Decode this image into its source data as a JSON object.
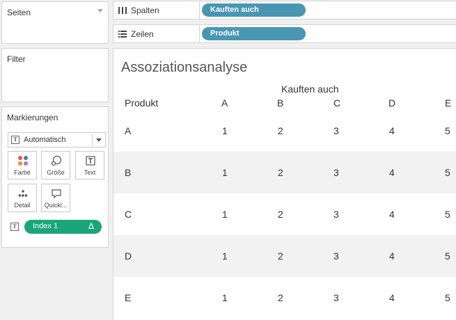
{
  "left": {
    "pages_title": "Seiten",
    "filter_title": "Filter",
    "marks_title": "Markierungen",
    "mark_type": "Automatisch",
    "mark_buttons": [
      "Farbe",
      "Größe",
      "Text",
      "Detail",
      "Quickl..."
    ],
    "mark_field": "Index 1",
    "mark_field_delta": "Δ",
    "mark_field_color": "#1aa67a"
  },
  "shelves": {
    "columns_label": "Spalten",
    "columns_pill": "Kauften auch",
    "rows_label": "Zeilen",
    "rows_pill": "Produkt",
    "pill_color": "#4996b2"
  },
  "viz": {
    "title": "Assoziationsanalyse",
    "column_group_header": "Kauften auch",
    "row_header": "Produkt",
    "columns": [
      "A",
      "B",
      "C",
      "D",
      "E"
    ],
    "rows": [
      {
        "label": "A",
        "values": [
          "1",
          "2",
          "3",
          "4",
          "5"
        ]
      },
      {
        "label": "B",
        "values": [
          "1",
          "2",
          "3",
          "4",
          "5"
        ]
      },
      {
        "label": "C",
        "values": [
          "1",
          "2",
          "3",
          "4",
          "5"
        ]
      },
      {
        "label": "D",
        "values": [
          "1",
          "2",
          "3",
          "4",
          "5"
        ]
      },
      {
        "label": "E",
        "values": [
          "1",
          "2",
          "3",
          "4",
          "5"
        ]
      }
    ]
  }
}
